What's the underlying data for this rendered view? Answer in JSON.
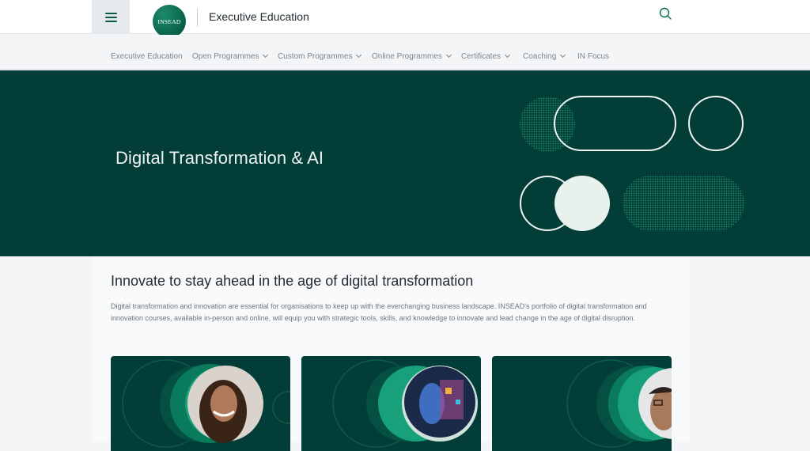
{
  "header": {
    "menu_icon": "hamburger-menu-icon",
    "logo_text": "INSEAD",
    "title": "Executive Education",
    "search_icon": "search-icon"
  },
  "nav": {
    "items": [
      {
        "label": "Executive Education",
        "dropdown": false
      },
      {
        "label": "Open Programmes",
        "dropdown": true
      },
      {
        "label": "Custom Programmes",
        "dropdown": true
      },
      {
        "label": "Online Programmes",
        "dropdown": true
      },
      {
        "label": "Certificates",
        "dropdown": true
      },
      {
        "label": "Coaching",
        "dropdown": true
      },
      {
        "label": "IN Focus",
        "dropdown": false
      }
    ]
  },
  "hero": {
    "title": "Digital Transformation & AI",
    "background_color": "#023e37"
  },
  "intro": {
    "heading": "Innovate to stay ahead in the age of digital transformation",
    "body": "Digital transformation and innovation are essential for organisations to keep up with the everchanging business landscape. INSEAD's portfolio of digital transformation and innovation courses, available in-person and online, will equip you with strategic tools, skills, and knowledge to innovate and lead change in the age of digital disruption."
  },
  "cards": [
    {
      "image": "woman-portrait-photo"
    },
    {
      "image": "ai-face-illustration"
    },
    {
      "image": "man-portrait-photo"
    }
  ],
  "colors": {
    "brand_green": "#023e37",
    "accent_green": "#0b6a50"
  }
}
